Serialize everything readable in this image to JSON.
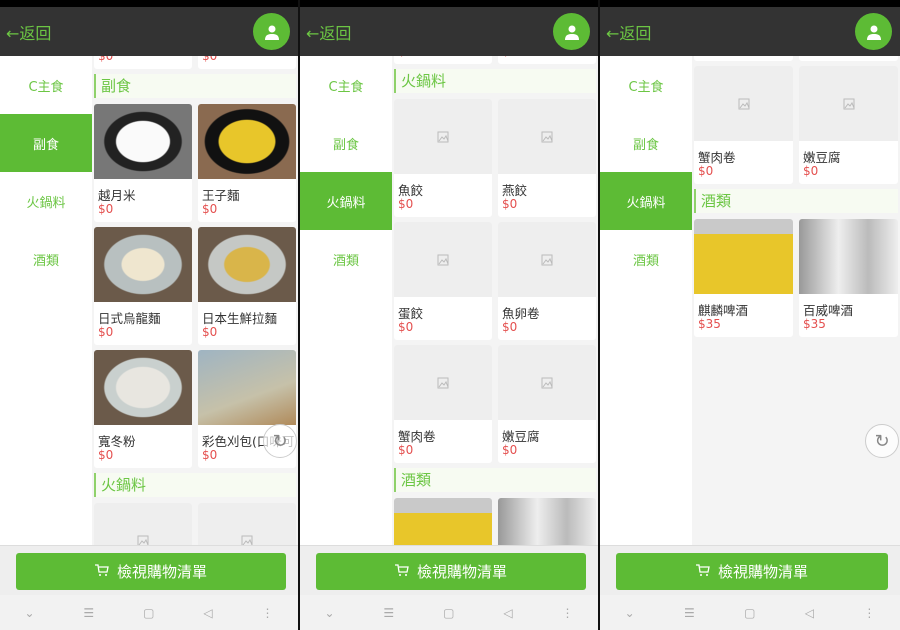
{
  "header": {
    "back_label": "←返回",
    "avatar_icon": "user-icon"
  },
  "sidebar": [
    "C主食",
    "副食",
    "火鍋料",
    "酒類"
  ],
  "cart_button": {
    "label": "檢視購物清單",
    "icon": "cart-icon"
  },
  "nav_icons": [
    "chevron-down-icon",
    "menu-icon",
    "home-square-icon",
    "back-triangle-icon",
    "more-icon"
  ],
  "colors": {
    "accent": "#5dbb35",
    "price": "#e4504f",
    "header": "#333333"
  },
  "sections": [
    {
      "title": "",
      "items": [
        {
          "name": "",
          "price": "$0"
        },
        {
          "name": "",
          "price": "$0"
        }
      ]
    },
    {
      "title": "副食",
      "items": [
        {
          "name": "越月米",
          "price": "$0",
          "photo": "rice"
        },
        {
          "name": "王子麵",
          "price": "$0",
          "photo": "noodle-pack"
        },
        {
          "name": "日式烏龍麵",
          "price": "$0",
          "photo": "udon"
        },
        {
          "name": "日本生鮮拉麵",
          "price": "$0",
          "photo": "ramen"
        },
        {
          "name": "寬冬粉",
          "price": "$0",
          "photo": "vermicelli"
        },
        {
          "name": "彩色刈包(口味可",
          "price": "$0",
          "photo": "buns"
        }
      ]
    },
    {
      "title": "火鍋料",
      "items": [
        {
          "name": "魚餃",
          "price": "$0"
        },
        {
          "name": "燕餃",
          "price": "$0"
        },
        {
          "name": "蛋餃",
          "price": "$0"
        },
        {
          "name": "魚卵卷",
          "price": "$0"
        },
        {
          "name": "蟹肉卷",
          "price": "$0"
        },
        {
          "name": "嫩豆腐",
          "price": "$0"
        }
      ]
    },
    {
      "title": "酒類",
      "items": [
        {
          "name": "麒麟啤酒",
          "price": "$35",
          "photo": "kirin"
        },
        {
          "name": "百威啤酒",
          "price": "$35",
          "photo": "budweiser"
        }
      ]
    }
  ],
  "panels": [
    {
      "active_category": 1,
      "refresh": true
    },
    {
      "active_category": 2,
      "refresh": false
    },
    {
      "active_category": 2,
      "refresh": true
    }
  ]
}
